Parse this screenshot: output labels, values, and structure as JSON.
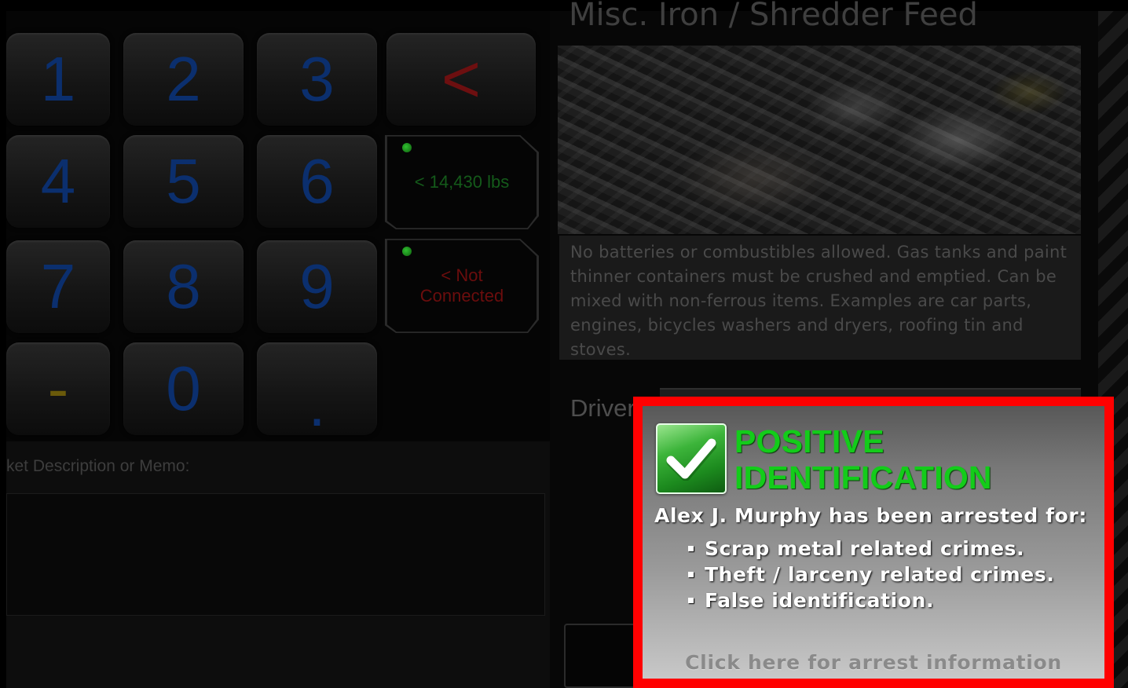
{
  "keypad": {
    "keys": [
      "1",
      "2",
      "3",
      "<",
      "4",
      "5",
      "6",
      "7",
      "8",
      "9",
      "-",
      "0",
      "."
    ]
  },
  "scale": {
    "weight_text": "< 14,430 lbs",
    "connection_line1": "< Not",
    "connection_line2": "Connected"
  },
  "memo": {
    "label": "ket Description or Memo:",
    "value": ""
  },
  "material": {
    "title": "Misc. Iron / Shredder Feed",
    "description": "No batteries or combustibles allowed. Gas tanks and paint thinner containers must be crushed and emptied. Can be mixed with non-ferrous items. Examples are car parts, engines, bicycles washers and dryers, roofing tin and stoves.",
    "driver_label": "Driver"
  },
  "alert": {
    "title_line1": "POSITIVE",
    "title_line2": "IDENTIFICATION",
    "arrest_text": "Alex J. Murphy has been arrested for:",
    "crimes": [
      "Scrap metal related crimes.",
      "Theft / larceny related crimes.",
      "False identification."
    ],
    "link_text": "Click here for arrest information",
    "border_color": "#ff0000",
    "title_color": "#13cc1a"
  },
  "icons": {
    "alert_icon": "green-checkmark-icon",
    "status_indicator": "green-led-icon"
  }
}
